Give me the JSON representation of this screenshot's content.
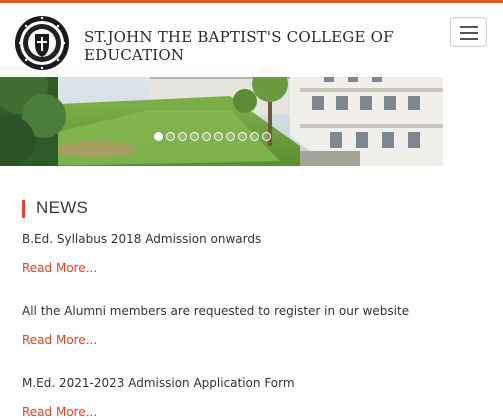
{
  "header": {
    "college_name": "ST.JOHN THE BAPTIST'S COLLEGE OF EDUCATION",
    "menu_icon": "hamburger-menu-icon",
    "logo": "college-crest-logo"
  },
  "carousel": {
    "slide_count": 10,
    "active_index": 0
  },
  "news": {
    "title": "NEWS",
    "items": [
      {
        "text": "B.Ed. Syllabus 2018 Admission onwards",
        "link": "Read More..."
      },
      {
        "text": "All the Alumni members are requested to register in our website",
        "link": "Read More..."
      },
      {
        "text": "M.Ed. 2021-2023 Admission Application Form",
        "link": "Read More..."
      }
    ]
  },
  "colors": {
    "accent": "#e8452c",
    "link": "#d9452c",
    "top_stripe": "#e05a2b"
  }
}
